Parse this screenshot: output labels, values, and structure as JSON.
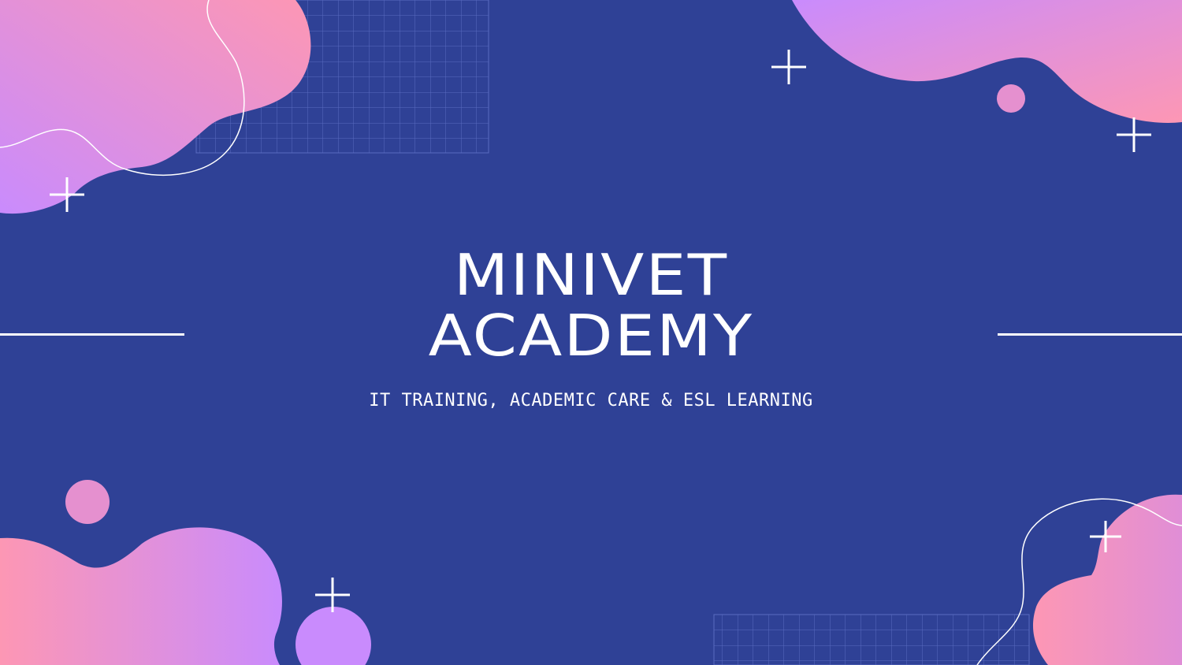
{
  "slide": {
    "title_line_1": "MINIVET",
    "title_line_2": "ACADEMY",
    "subtitle": "IT TRAINING, ACADEMIC CARE & ESL LEARNING"
  },
  "colors": {
    "background": "#2f4196",
    "pink": "#fd97b4",
    "violet": "#c98bfd",
    "white": "#ffffff",
    "grid": "#5a6bc0"
  },
  "decorations": {
    "blobs": [
      "top-left-blob",
      "top-right-blob",
      "bottom-left-blob",
      "bottom-right-blob"
    ],
    "sparkles": [
      "plus-icon",
      "plus-icon",
      "plus-icon",
      "plus-icon",
      "plus-icon"
    ],
    "grids": [
      "grid-pattern-top",
      "grid-pattern-bottom"
    ]
  }
}
